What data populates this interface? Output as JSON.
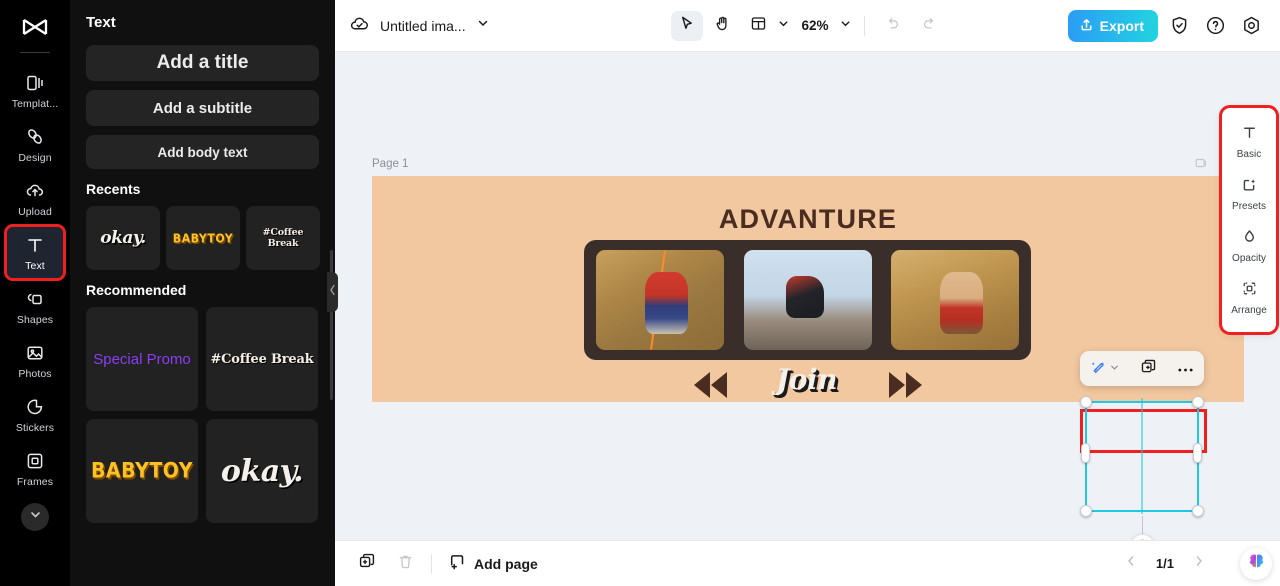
{
  "app": {
    "logo_icon": "capcut-logo-icon"
  },
  "rail": {
    "items": [
      {
        "label": "Templat...",
        "icon": "templates-icon",
        "name": "templates"
      },
      {
        "label": "Design",
        "icon": "design-icon",
        "name": "design"
      },
      {
        "label": "Upload",
        "icon": "upload-cloud-icon",
        "name": "upload"
      },
      {
        "label": "Text",
        "icon": "text-t-icon",
        "name": "text"
      },
      {
        "label": "Shapes",
        "icon": "shapes-icon",
        "name": "shapes"
      },
      {
        "label": "Photos",
        "icon": "photos-icon",
        "name": "photos"
      },
      {
        "label": "Stickers",
        "icon": "stickers-icon",
        "name": "stickers"
      },
      {
        "label": "Frames",
        "icon": "frames-icon",
        "name": "frames"
      }
    ],
    "active_item": "Text",
    "expand_icon": "chevron-down-icon"
  },
  "panel": {
    "title": "Text",
    "buttons": {
      "add_title": "Add a title",
      "add_subtitle": "Add a subtitle",
      "add_body": "Add body text"
    },
    "recents_heading": "Recents",
    "recents": [
      {
        "label": "okay.",
        "style": "okay"
      },
      {
        "label": "BABYTOY",
        "style": "baby"
      },
      {
        "label": "#Coffee Break",
        "style": "coffee"
      }
    ],
    "recommended_heading": "Recommended",
    "recommended": [
      {
        "label": "Special Promo",
        "style": "promo"
      },
      {
        "label": "#Coffee Break",
        "style": "coffee"
      },
      {
        "label": "BABYTOY",
        "style": "baby"
      },
      {
        "label": "okay.",
        "style": "okay"
      }
    ],
    "collapse_icon": "chevron-left-icon"
  },
  "topbar": {
    "cloud_icon": "cloud-saved-icon",
    "doc_name": "Untitled ima...",
    "doc_chevron_icon": "chevron-down-icon",
    "tools": [
      {
        "name": "select-cursor",
        "icon": "cursor-arrow-icon",
        "selected": true
      },
      {
        "name": "hand-pan",
        "icon": "hand-icon",
        "selected": false
      },
      {
        "name": "layout-view",
        "icon": "layout-panel-icon",
        "selected": false
      }
    ],
    "layout_chevron_icon": "chevron-down-icon",
    "zoom_value": "62%",
    "zoom_chevron_icon": "chevron-down-icon",
    "undo_icon": "undo-arrow-icon",
    "redo_icon": "redo-arrow-icon",
    "export_label": "Export",
    "export_icon": "upload-share-icon",
    "export_color": "#22c8e0",
    "shield_icon": "shield-check-icon",
    "help_icon": "question-circle-icon",
    "settings_icon": "gear-hex-icon"
  },
  "canvas": {
    "page_label": "Page 1",
    "page_corner_icon": "image-thumb-icon",
    "background_color": "#eef1f5",
    "artboard": {
      "background_color": "#f2c8a0",
      "title": "ADVANTURE",
      "title_color": "#4a2d20",
      "filmstrip_color": "#3a2e2a",
      "photos": [
        {
          "alt": "climber-in-red-jacket-on-rock-face"
        },
        {
          "alt": "hiker-on-summit-against-sky"
        },
        {
          "alt": "shirtless-climber-on-cliff"
        }
      ],
      "rewind_icon": "rewind-double-arrow-icon",
      "forward_icon": "fast-forward-double-arrow-icon",
      "selected_text": "Join"
    },
    "context_toolbar": {
      "magic_icon": "magic-wand-edit-icon",
      "magic_chevron_icon": "chevron-down-icon",
      "duplicate_icon": "duplicate-layers-icon",
      "more_icon": "more-horizontal-icon"
    },
    "selection": {
      "handle_color": "#1fc8e3",
      "highlight_color": "#f02020",
      "rotate_icon": "rotate-icon"
    }
  },
  "right_panel": {
    "highlight_color": "#f02020",
    "items": [
      {
        "label": "Basic",
        "icon": "text-t-icon"
      },
      {
        "label": "Presets",
        "icon": "presets-star-icon"
      },
      {
        "label": "Opacity",
        "icon": "opacity-droplet-icon"
      },
      {
        "label": "Arrange",
        "icon": "arrange-frame-icon"
      }
    ]
  },
  "bottombar": {
    "duplicate_page_icon": "duplicate-page-icon",
    "delete_page_icon": "trash-icon",
    "add_page_label": "Add page",
    "add_page_icon": "add-page-square-icon",
    "prev_icon": "chevron-left-icon",
    "page_count": "1/1",
    "next_icon": "chevron-right-icon",
    "ai_icon": "ai-brain-icon"
  }
}
